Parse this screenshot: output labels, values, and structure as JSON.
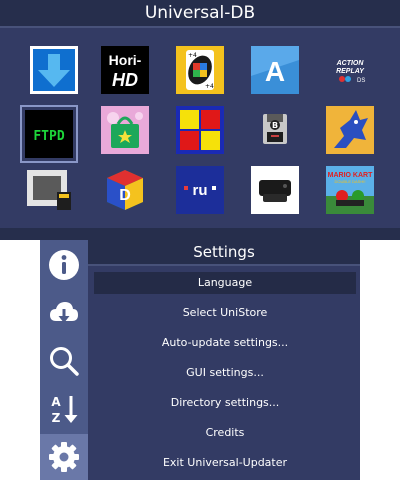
{
  "top_screen": {
    "title": "Universal-DB",
    "tiles": [
      {
        "name": "download-arrow-app-icon"
      },
      {
        "name": "hori-hd-app-icon",
        "text_line1": "Hori-",
        "text_line2": "HD"
      },
      {
        "name": "uno-card-app-icon",
        "text": "UNO",
        "corner_top": "+4",
        "corner_bottom": "+4"
      },
      {
        "name": "a-letter-app-icon",
        "text": "A"
      },
      {
        "name": "action-replay-app-icon",
        "text_line1": "ACTION",
        "text_line2": "REPLAY",
        "text_line3": "DS"
      },
      {
        "name": "ftpd-app-icon",
        "text": "FTPD"
      },
      {
        "name": "shopping-bag-app-icon"
      },
      {
        "name": "four-squares-app-icon"
      },
      {
        "name": "floppy-disk-app-icon",
        "text": "B"
      },
      {
        "name": "blue-creature-app-icon"
      },
      {
        "name": "sd-card-screen-app-icon"
      },
      {
        "name": "n64-cube-app-icon",
        "text": "D"
      },
      {
        "name": "ru-app-icon",
        "text": "ru"
      },
      {
        "name": "game-console-app-icon"
      },
      {
        "name": "mario-kart-app-icon",
        "text_line1": "MARIO KART",
        "text_line2": "DOUBLE DASH!!"
      }
    ],
    "colors": {
      "background": "#333b64",
      "header": "#262e4c"
    }
  },
  "bottom_screen": {
    "title": "Settings",
    "sidebar": [
      {
        "icon": "info-icon",
        "active": false
      },
      {
        "icon": "cloud-download-icon",
        "active": false
      },
      {
        "icon": "search-icon",
        "active": false
      },
      {
        "icon": "sort-az-icon",
        "text_top": "A",
        "text_bottom": "Z",
        "active": false
      },
      {
        "icon": "gear-icon",
        "active": true
      }
    ],
    "menu": [
      {
        "label": "Language",
        "selected": true
      },
      {
        "label": "Select UniStore",
        "selected": false
      },
      {
        "label": "Auto-update settings...",
        "selected": false
      },
      {
        "label": "GUI settings...",
        "selected": false
      },
      {
        "label": "Directory settings...",
        "selected": false
      },
      {
        "label": "Credits",
        "selected": false
      },
      {
        "label": "Exit Universal-Updater",
        "selected": false
      }
    ],
    "colors": {
      "sidebar": "#4c5a89",
      "active_sidebar": "#6a78a8",
      "selected_item": "#242b47"
    }
  }
}
